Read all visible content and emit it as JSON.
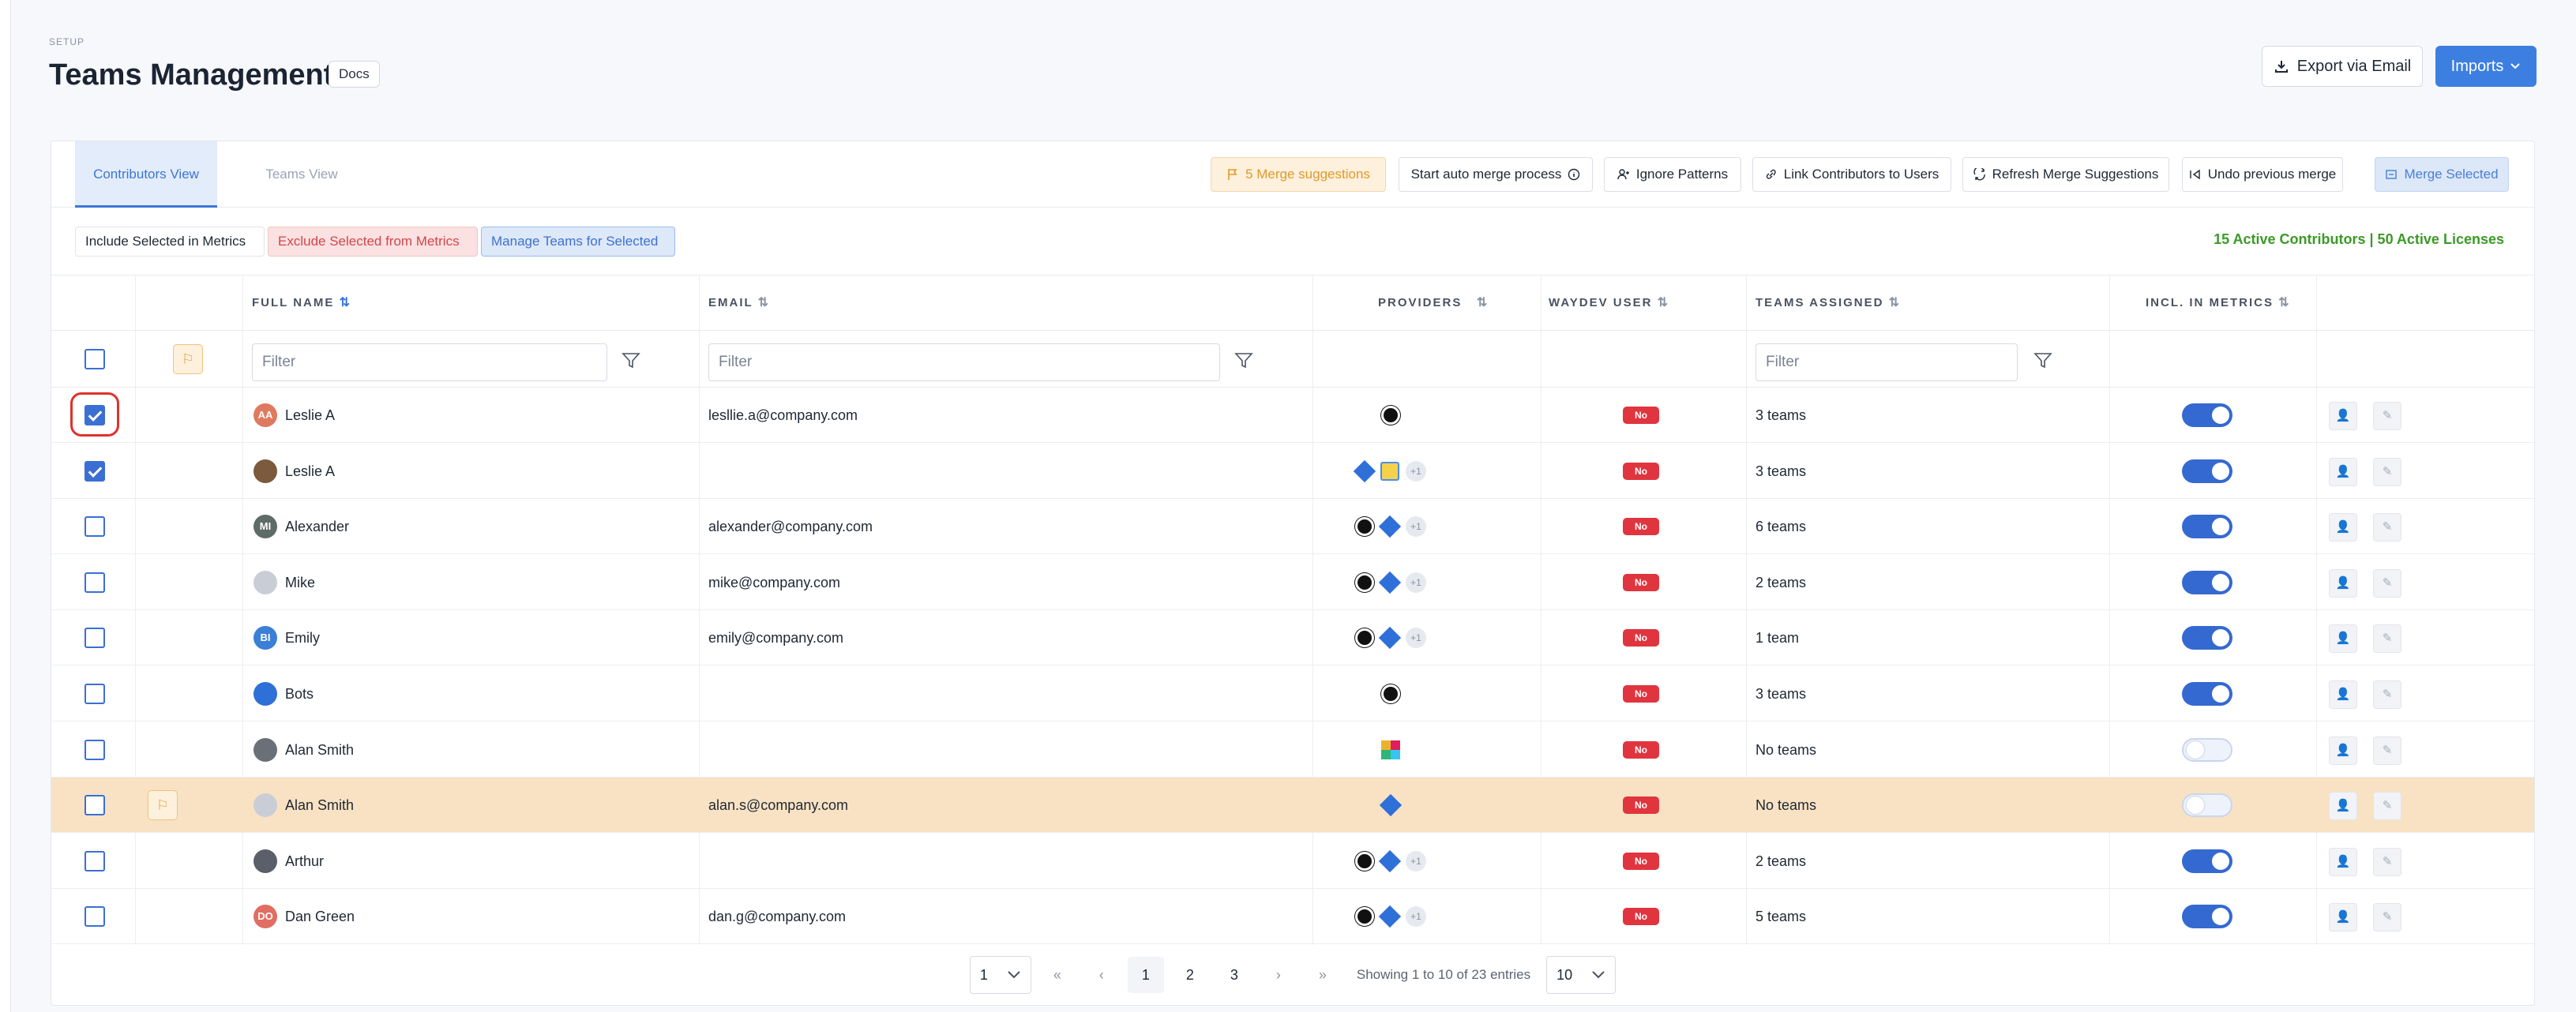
{
  "header": {
    "section": "SETUP",
    "title": "Teams Management",
    "docs_label": "Docs",
    "export_label": "Export via Email",
    "imports_label": "Imports"
  },
  "tabs": {
    "contributors": "Contributors View",
    "teams": "Teams View"
  },
  "toolbar": {
    "merge_suggestions": "5 Merge suggestions",
    "auto_merge": "Start auto merge process",
    "ignore_patterns": "Ignore Patterns",
    "link_contributors": "Link Contributors to Users",
    "refresh_suggestions": "Refresh Merge Suggestions",
    "undo_merge": "Undo previous merge",
    "merge_selected": "Merge Selected"
  },
  "bulk": {
    "include": "Include Selected in Metrics",
    "exclude": "Exclude Selected from Metrics",
    "manage": "Manage Teams for Selected",
    "summary": "15 Active Contributors | 50 Active Licenses"
  },
  "columns": {
    "full_name": "FULL NAME",
    "email": "EMAIL",
    "providers": "PROVIDERS",
    "waydev_user": "WAYDEV USER",
    "teams_assigned": "TEAMS ASSIGNED",
    "incl_metrics": "INCL. IN METRICS"
  },
  "filters": {
    "name_placeholder": "Filter",
    "email_placeholder": "Filter",
    "teams_placeholder": "Filter"
  },
  "colors": {
    "accent": "#3b6fd3",
    "warning": "#e9a23d",
    "danger": "#e0353f",
    "success": "#3b9a26",
    "highlight_row": "#f8e2c3"
  },
  "rows": [
    {
      "checked": true,
      "flag": false,
      "initials": "AA",
      "avatar_color": "#e07a5f",
      "name": "Leslie A",
      "email": "lesllie.a@company.com",
      "providers": [
        "github"
      ],
      "extra": "",
      "waydev": "No",
      "teams": "3 teams",
      "incl": true
    },
    {
      "checked": true,
      "flag": false,
      "initials": "",
      "avatar_color": "#7b5a3e",
      "name": "Leslie A",
      "email": "",
      "providers": [
        "jira",
        "calendar"
      ],
      "extra": "+1",
      "waydev": "No",
      "teams": "3 teams",
      "incl": true
    },
    {
      "checked": false,
      "flag": false,
      "initials": "MI",
      "avatar_color": "#5f6b66",
      "name": "Alexander",
      "email": "alexander@company.com",
      "providers": [
        "github",
        "jira"
      ],
      "extra": "+1",
      "waydev": "No",
      "teams": "6 teams",
      "incl": true
    },
    {
      "checked": false,
      "flag": false,
      "initials": "",
      "avatar_color": "#c9ced6",
      "name": "Mike",
      "email": "mike@company.com",
      "providers": [
        "github",
        "jira"
      ],
      "extra": "+1",
      "waydev": "No",
      "teams": "2 teams",
      "incl": true
    },
    {
      "checked": false,
      "flag": false,
      "initials": "BI",
      "avatar_color": "#3b7fd6",
      "name": "Emily",
      "email": "emily@company.com",
      "providers": [
        "github",
        "jira"
      ],
      "extra": "+1",
      "waydev": "No",
      "teams": "1 team",
      "incl": true
    },
    {
      "checked": false,
      "flag": false,
      "initials": "",
      "avatar_color": "#2f6fd8",
      "name": "Bots",
      "email": "",
      "providers": [
        "github"
      ],
      "extra": "",
      "waydev": "No",
      "teams": "3 teams",
      "incl": true
    },
    {
      "checked": false,
      "flag": false,
      "initials": "",
      "avatar_color": "#6b6f78",
      "name": "Alan Smith",
      "email": "",
      "providers": [
        "slack"
      ],
      "extra": "",
      "waydev": "No",
      "teams": "No teams",
      "incl": false
    },
    {
      "checked": false,
      "flag": true,
      "initials": "",
      "avatar_color": "#c9ced6",
      "name": "Alan Smith",
      "email": "alan.s@company.com",
      "providers": [
        "jira"
      ],
      "extra": "",
      "waydev": "No",
      "teams": "No teams",
      "incl": false
    },
    {
      "checked": false,
      "flag": false,
      "initials": "",
      "avatar_color": "#5a5f6a",
      "name": "Arthur",
      "email": "",
      "providers": [
        "github",
        "jira"
      ],
      "extra": "+1",
      "waydev": "No",
      "teams": "2 teams",
      "incl": true
    },
    {
      "checked": false,
      "flag": false,
      "initials": "DO",
      "avatar_color": "#e26d62",
      "name": "Dan Green",
      "email": "dan.g@company.com",
      "providers": [
        "github",
        "jira"
      ],
      "extra": "+1",
      "waydev": "No",
      "teams": "5 teams",
      "incl": true
    }
  ],
  "pagination": {
    "page_select": "1",
    "pages": [
      "1",
      "2",
      "3"
    ],
    "current": "1",
    "info": "Showing 1 to 10 of 23 entries",
    "page_size": "10"
  }
}
